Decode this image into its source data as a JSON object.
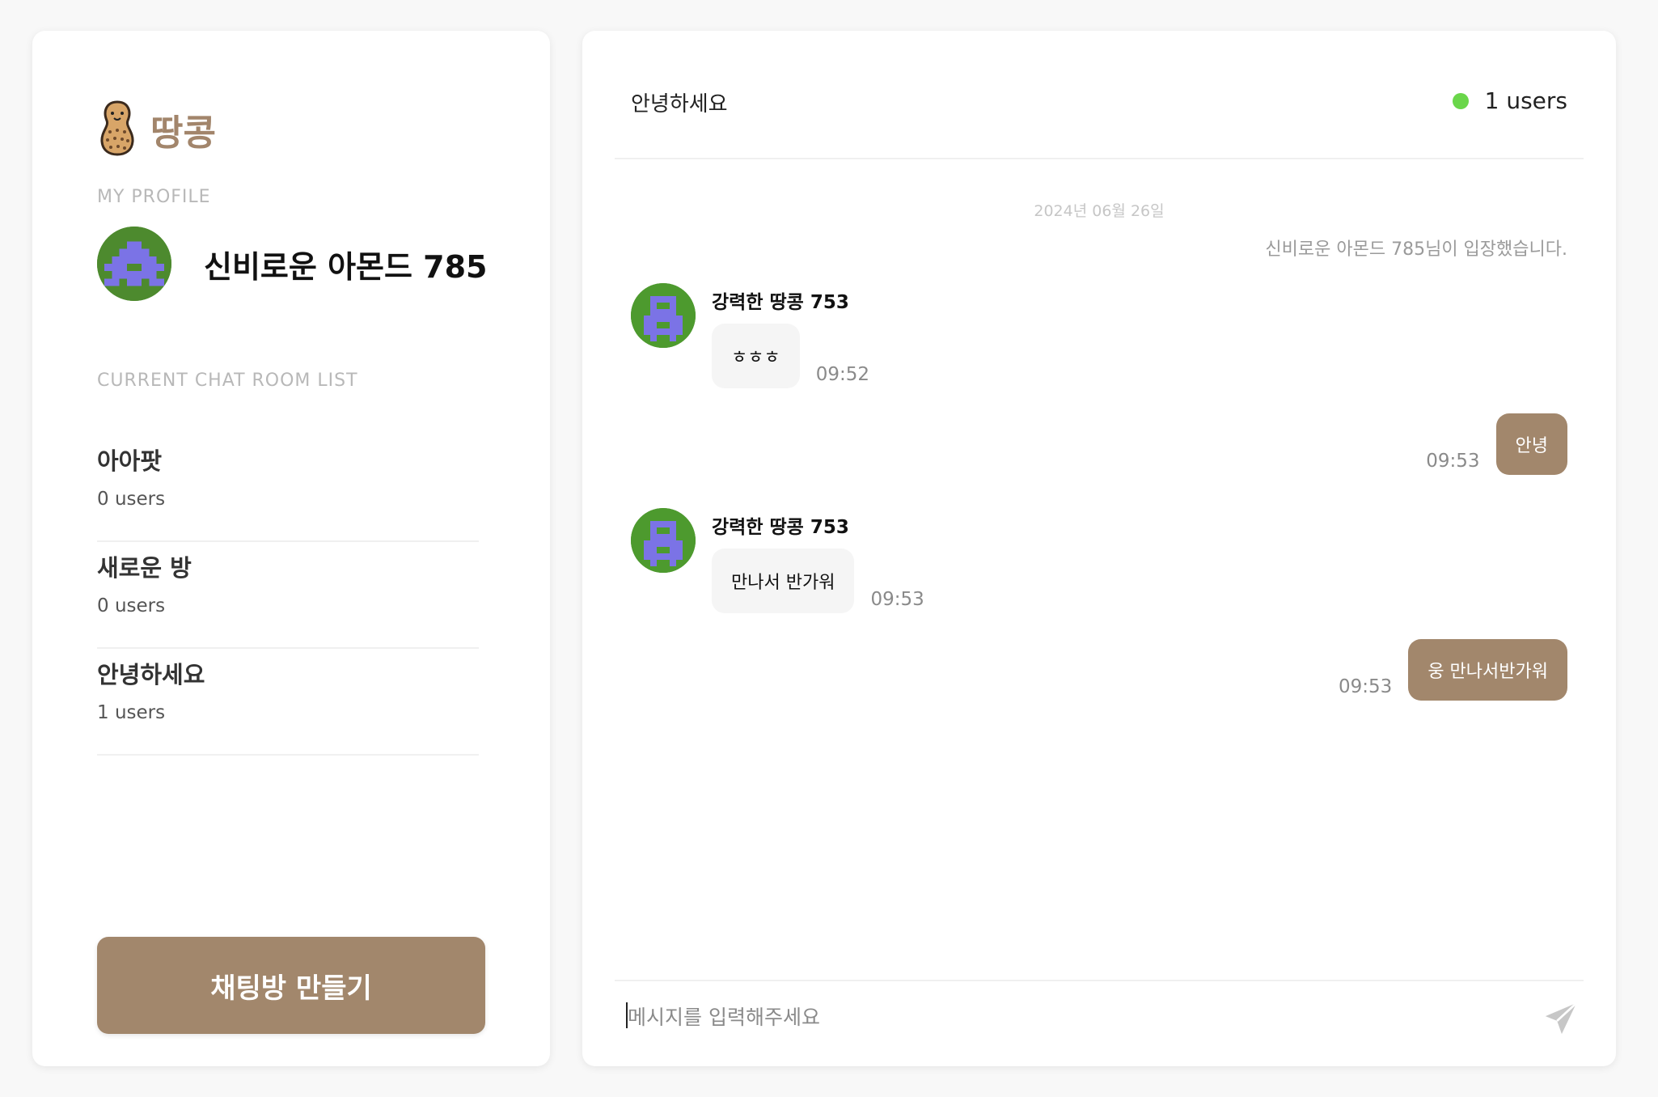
{
  "brand": {
    "name": "땅콩",
    "logo_icon": "peanut-icon"
  },
  "profile": {
    "section_label": "MY PROFILE",
    "name": "신비로운 아몬드 785",
    "avatar_bg": "#4d8a2e",
    "avatar_fg": "#7b73e6"
  },
  "rooms": {
    "section_label": "CURRENT CHAT ROOM LIST",
    "items": [
      {
        "name": "아아팟",
        "users": "0 users"
      },
      {
        "name": "새로운 방",
        "users": "0 users"
      },
      {
        "name": "안녕하세요",
        "users": "1 users"
      }
    ]
  },
  "create_button": {
    "label": "채팅방 만들기"
  },
  "chat": {
    "room_title": "안녕하세요",
    "online_count": "1 users",
    "online_color": "#6ad64a",
    "date": "2024년 06월 26일",
    "system_message": "신비로운 아몬드 785님이 입장했습니다.",
    "messages": [
      {
        "direction": "in",
        "sender": "강력한 땅콩 753",
        "text": "ㅎㅎㅎ",
        "time": "09:52"
      },
      {
        "direction": "out",
        "text": "안녕",
        "time": "09:53"
      },
      {
        "direction": "in",
        "sender": "강력한 땅콩 753",
        "text": "만나서 반가워",
        "time": "09:53"
      },
      {
        "direction": "out",
        "text": "웅 만나서반가워",
        "time": "09:53"
      }
    ]
  },
  "composer": {
    "placeholder": "메시지를 입력해주세요",
    "value": "",
    "send_icon": "paper-plane-icon"
  },
  "colors": {
    "accent": "#a2876c",
    "brand_text": "#a2856b",
    "background": "#f8f8f8"
  }
}
